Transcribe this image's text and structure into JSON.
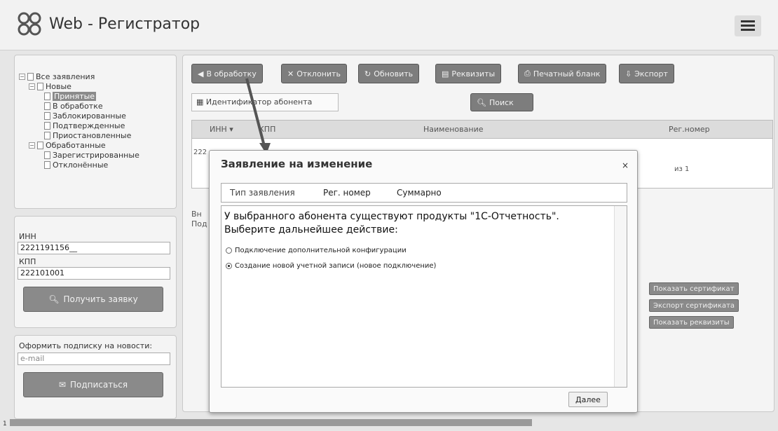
{
  "app": {
    "title": "Web - Регистратор"
  },
  "tree": {
    "items": [
      {
        "label": "Все заявления"
      },
      {
        "label": "Новые"
      },
      {
        "label": "Принятые"
      },
      {
        "label": "В обработке"
      },
      {
        "label": "Заблокированные"
      },
      {
        "label": "Подтвержденные"
      },
      {
        "label": "Приостановленные"
      },
      {
        "label": "Обработанные"
      },
      {
        "label": "Зарегистрированные"
      },
      {
        "label": "Отклонённые"
      }
    ]
  },
  "form": {
    "inn_label": "ИНН",
    "inn_value": "2221191156__",
    "kpp_label": "КПП",
    "kpp_value": "222101001",
    "get_button": "Получить заявку"
  },
  "subscribe": {
    "label": "Оформить подписку на новости:",
    "email_placeholder": "e-mail",
    "button": "Подписаться"
  },
  "toolbar": {
    "in_work": "В обработку",
    "reject": "Отклонить",
    "refresh": "Обновить",
    "details": "Реквизиты",
    "print": "Печатный бланк",
    "export": "Экспорт"
  },
  "search": {
    "placeholder": "Идентификатор абонента",
    "button": "Поиск"
  },
  "grid": {
    "columns": {
      "inn": "ИНН",
      "kpp": "КПП",
      "name": "Наименование",
      "reg": "Рег.номер"
    },
    "row_inn_fragment": "222",
    "pager_total": "из 1",
    "left_frag_1": "Вн",
    "left_frag_2": "Под"
  },
  "side_buttons": {
    "show_cert": "Показать сертификат",
    "export_cert": "Экспорт сертификата",
    "show_details": "Показать реквизиты"
  },
  "modal": {
    "title": "Заявление на изменение",
    "close": "×",
    "tabs": [
      "Тип заявления",
      "Рег. номер",
      "Суммарно"
    ],
    "message": "У выбранного абонента существуют продукты \"1С-Отчетность\". Выберите дальнейшее действие:",
    "options": [
      {
        "label": "Подключение дополнительной конфигурации",
        "selected": false
      },
      {
        "label": "Создание новой учетной записи (новое подключение)",
        "selected": true
      }
    ],
    "next": "Далее"
  },
  "page_number": "1"
}
